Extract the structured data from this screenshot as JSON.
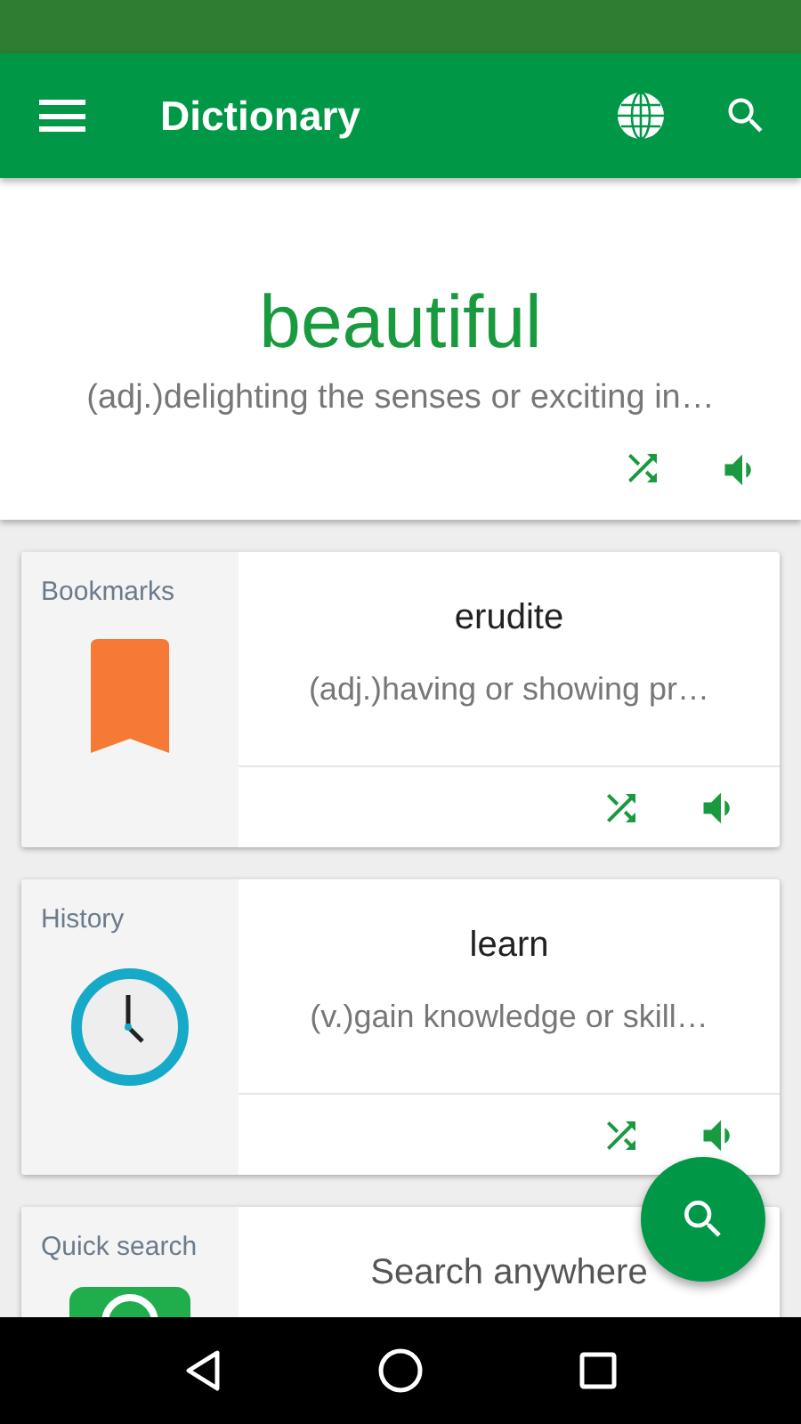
{
  "app_bar": {
    "title": "Dictionary"
  },
  "word_of_day": {
    "word": "beautiful",
    "definition": "(adj.)delighting the senses or exciting in…"
  },
  "cards": [
    {
      "kind": "bookmark",
      "label": "Bookmarks",
      "word": "erudite",
      "definition": "(adj.)having or showing pr…"
    },
    {
      "kind": "history",
      "label": "History",
      "word": "learn",
      "definition": "(v.)gain knowledge or skill…"
    },
    {
      "kind": "quick_search",
      "label": "Quick search",
      "prompt": "Search anywhere"
    }
  ]
}
